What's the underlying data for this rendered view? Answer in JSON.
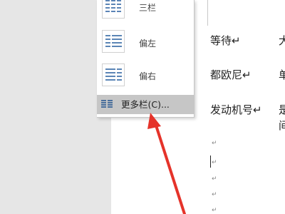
{
  "columns_menu": {
    "items": [
      {
        "label": "三栏",
        "icon": "three-columns-icon"
      },
      {
        "label": "偏左",
        "icon": "left-column-icon"
      },
      {
        "label": "偏右",
        "icon": "right-column-icon"
      }
    ],
    "more_label": "更多栏(C)...",
    "more_icon": "more-columns-icon",
    "accent_color": "#5b85b6",
    "hover_color": "#c6c6c6"
  },
  "document": {
    "rows": [
      {
        "left": "等待↵",
        "right": "大"
      },
      {
        "left": "都欧尼↵",
        "right": "单"
      },
      {
        "left": "发动机号↵",
        "right": "是",
        "right2": "间"
      }
    ],
    "paragraph_mark": "↵"
  },
  "annotation": {
    "arrow_color": "#e5332a",
    "arrow_icon": "red-arrow-pointer-icon"
  }
}
